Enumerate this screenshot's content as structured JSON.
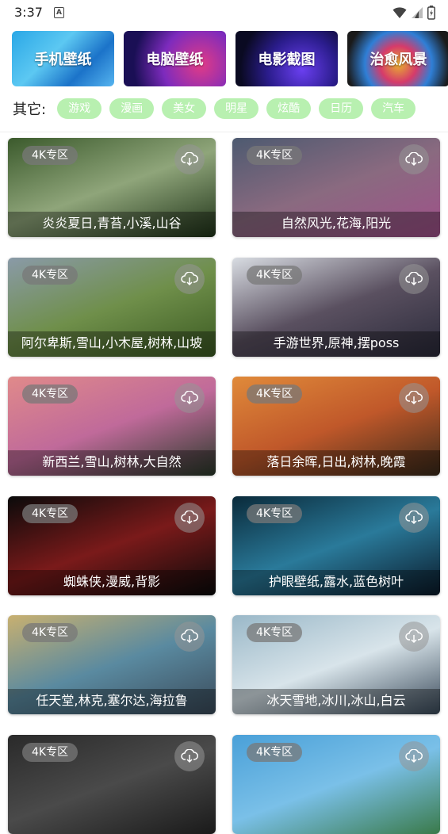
{
  "status_bar": {
    "time": "3:37",
    "notif_letter": "A"
  },
  "categories": [
    {
      "label": "手机壁纸"
    },
    {
      "label": "电脑壁纸"
    },
    {
      "label": "电影截图"
    },
    {
      "label": "治愈风景"
    }
  ],
  "tags": {
    "label": "其它:",
    "items": [
      "游戏",
      "漫画",
      "美女",
      "明星",
      "炫酷",
      "日历",
      "汽车"
    ]
  },
  "wallpapers": [
    {
      "badge": "4K专区",
      "caption": "炎炎夏日,青苔,小溪,山谷",
      "colors": [
        "#3b5a2c",
        "#8fa57a",
        "#1f3318"
      ]
    },
    {
      "badge": "4K专区",
      "caption": "自然风光,花海,阳光",
      "colors": [
        "#4d5a70",
        "#8a6a80",
        "#a0508a"
      ]
    },
    {
      "badge": "4K专区",
      "caption": "阿尔卑斯,雪山,小木屋,树林,山坡",
      "colors": [
        "#8a9aa8",
        "#6f8f4a",
        "#3b5a22"
      ]
    },
    {
      "badge": "4K专区",
      "caption": "手游世界,原神,摆poss",
      "colors": [
        "#d8dce2",
        "#5a5060",
        "#2a2a3a"
      ]
    },
    {
      "badge": "4K专区",
      "caption": "新西兰,雪山,树林,大自然",
      "colors": [
        "#e08a8a",
        "#c06a9a",
        "#2a3a2a"
      ]
    },
    {
      "badge": "4K专区",
      "caption": "落日余晖,日出,树林,晚霞",
      "colors": [
        "#e08a3a",
        "#c0582a",
        "#3a2a1a"
      ]
    },
    {
      "badge": "4K专区",
      "caption": "蜘蛛侠,漫威,背影",
      "colors": [
        "#0a0a0a",
        "#7a1a1a",
        "#0a0a0a"
      ]
    },
    {
      "badge": "4K专区",
      "caption": "护眼壁纸,露水,蓝色树叶",
      "colors": [
        "#0a2a3a",
        "#2a7a9a",
        "#0a1a2a"
      ]
    },
    {
      "badge": "4K专区",
      "caption": "任天堂,林克,塞尔达,海拉鲁",
      "colors": [
        "#c8b070",
        "#5a8aa0",
        "#3a4a5a"
      ]
    },
    {
      "badge": "4K专区",
      "caption": "冰天雪地,冰川,冰山,白云",
      "colors": [
        "#9ab8c8",
        "#d8e4ea",
        "#3a4a5a"
      ]
    },
    {
      "badge": "4K专区",
      "caption": "",
      "colors": [
        "#2a2a2a",
        "#4a4a4a",
        "#1a1a1a"
      ]
    },
    {
      "badge": "4K专区",
      "caption": "",
      "colors": [
        "#4aa0d8",
        "#7ac0e8",
        "#3a7a4a"
      ]
    }
  ]
}
